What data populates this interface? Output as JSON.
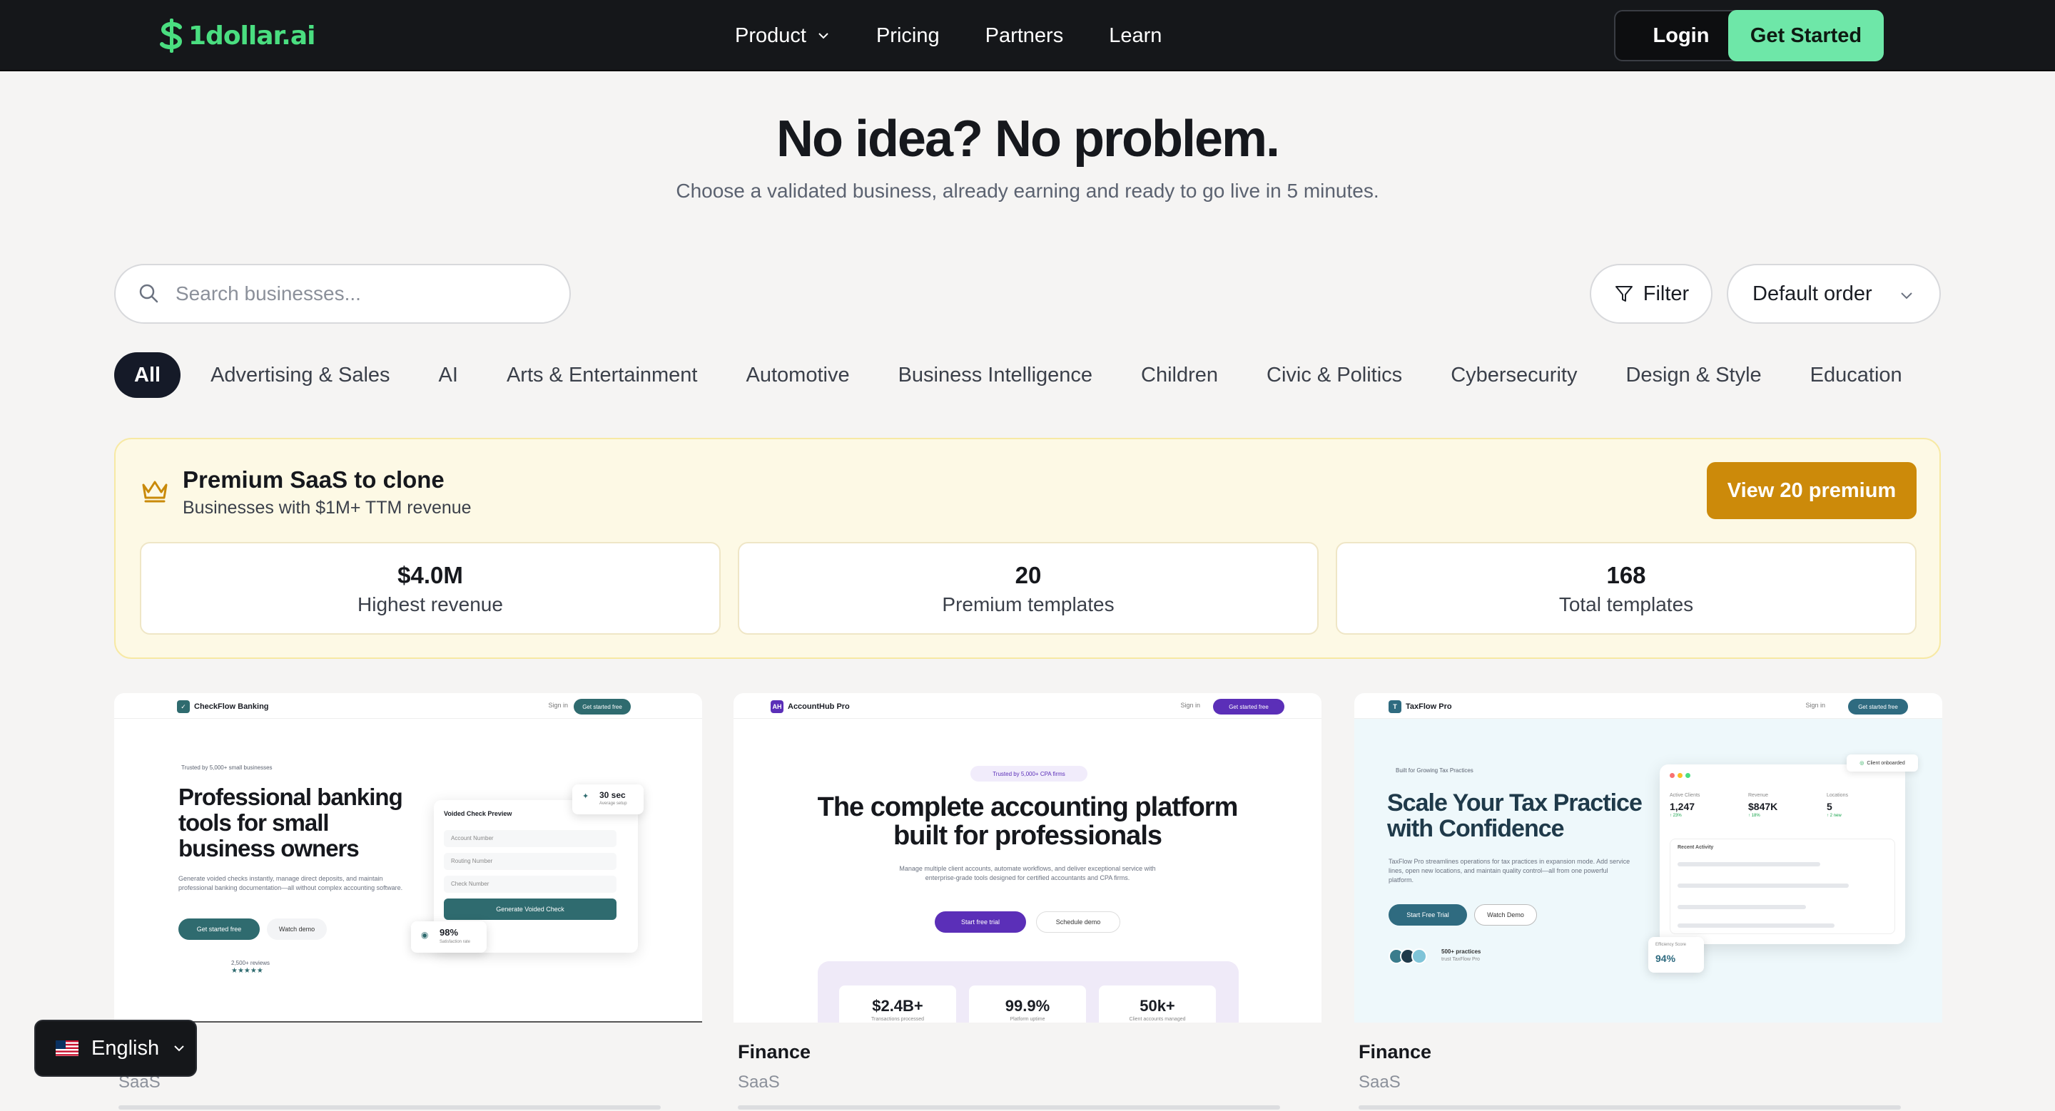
{
  "nav": {
    "logo": "1dollar.ai",
    "links": [
      "Product",
      "Pricing",
      "Partners",
      "Learn"
    ],
    "login": "Login",
    "get_started": "Get Started"
  },
  "hero": {
    "title": "No idea? No problem.",
    "subtitle": "Choose a validated business, already earning and ready to go live in 5 minutes."
  },
  "search": {
    "placeholder": "Search businesses...",
    "value": ""
  },
  "filter_label": "Filter",
  "sort": {
    "selected": "Default order"
  },
  "categories": [
    "All",
    "Advertising & Sales",
    "AI",
    "Arts & Entertainment",
    "Automotive",
    "Business Intelligence",
    "Children",
    "Civic & Politics",
    "Cybersecurity",
    "Design & Style",
    "Education"
  ],
  "active_category": "All",
  "premium": {
    "title": "Premium SaaS to clone",
    "subtitle": "Businesses with $1M+ TTM revenue",
    "button": "View 20 premium",
    "stats": [
      {
        "value": "$4.0M",
        "label": "Highest revenue"
      },
      {
        "value": "20",
        "label": "Premium templates"
      },
      {
        "value": "168",
        "label": "Total templates"
      }
    ]
  },
  "cards": [
    {
      "category": "",
      "type": "SaaS",
      "preview": {
        "brand": "CheckFlow Banking",
        "signin": "Sign in",
        "cta": "Get started free",
        "pill": "Trusted by 5,000+ small businesses",
        "headline": "Professional banking tools for small business owners",
        "body": "Generate voided checks instantly, manage direct deposits, and maintain professional banking documentation—all without complex accounting software.",
        "btn1": "Get started free",
        "btn2": "Watch demo",
        "reviews": "2,500+ reviews",
        "stars": "★★★★★",
        "panel_title": "Voided Check Preview",
        "fields": [
          "Account Number",
          "Routing Number",
          "Check Number"
        ],
        "panel_btn": "Generate Voided Check",
        "float1_value": "30 sec",
        "float1_label": "Average setup",
        "float2_value": "98%",
        "float2_label": "Satisfaction rate",
        "accent": "#2f6b6f"
      }
    },
    {
      "category": "Finance",
      "type": "SaaS",
      "preview": {
        "brand": "AccountHub Pro",
        "badge": "AH",
        "signin": "Sign in",
        "cta": "Get started free",
        "pill": "Trusted by 5,000+ CPA firms",
        "headline": "The complete accounting platform built for professionals",
        "body": "Manage multiple client accounts, automate workflows, and deliver exceptional service with enterprise-grade tools designed for certified accountants and CPA firms.",
        "btn1": "Start free trial",
        "btn2": "Schedule demo",
        "stats": [
          {
            "value": "$2.4B+",
            "label": "Transactions processed"
          },
          {
            "value": "99.9%",
            "label": "Platform uptime"
          },
          {
            "value": "50k+",
            "label": "Client accounts managed"
          }
        ],
        "accent": "#5b2fb8"
      }
    },
    {
      "category": "Finance",
      "type": "SaaS",
      "preview": {
        "brand": "TaxFlow Pro",
        "badge": "T",
        "signin": "Sign in",
        "cta": "Get started free",
        "pill": "Built for Growing Tax Practices",
        "headline": "Scale Your Tax Practice with Confidence",
        "body": "TaxFlow Pro streamlines operations for tax practices in expansion mode. Add service lines, open new locations, and maintain quality control—all from one powerful platform.",
        "btn1": "Start Free Trial",
        "btn2": "Watch Demo",
        "social": "500+ practices",
        "social_sub": "trust TaxFlow Pro",
        "onboard": "Client onboarded",
        "metrics": [
          {
            "label": "Active Clients",
            "value": "1,247",
            "delta": "↑ 23%"
          },
          {
            "label": "Revenue",
            "value": "$847K",
            "delta": "↑ 18%"
          },
          {
            "label": "Locations",
            "value": "5",
            "delta": "↑ 2 new"
          }
        ],
        "activity": "Recent Activity",
        "efficiency_label": "Efficiency Score",
        "efficiency": "94%",
        "accent": "#2f6b80"
      }
    }
  ],
  "language": {
    "label": "English"
  },
  "colors": {
    "brand": "#4ade80",
    "cta": "#6ee7a8",
    "premium_button": "#cc8a0a",
    "nav_bg": "#15171a"
  }
}
